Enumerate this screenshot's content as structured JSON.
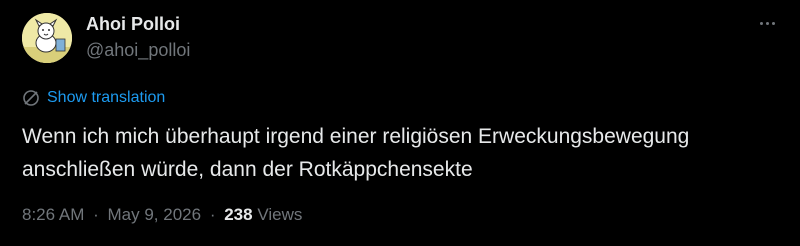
{
  "author": {
    "display_name": "Ahoi Polloi",
    "handle": "@ahoi_polloi",
    "avatar_icon": "cartoon-dog-avatar"
  },
  "translate": {
    "label": "Show translation",
    "icon": "globe-slash-icon"
  },
  "tweet": {
    "lines": [
      "Wenn ich mich überhaupt irgend einer religiösen Erweckungsbewegung",
      "anschließen würde, dann der Rotkäppchensekte"
    ]
  },
  "meta": {
    "time": "8:26 AM",
    "separator": "·",
    "date": "May 9, 2026",
    "views_count": "238",
    "views_label": "Views"
  },
  "colors": {
    "background": "#000000",
    "text_primary": "#e7e9ea",
    "text_secondary": "#71767b",
    "accent": "#1d9bf0"
  }
}
